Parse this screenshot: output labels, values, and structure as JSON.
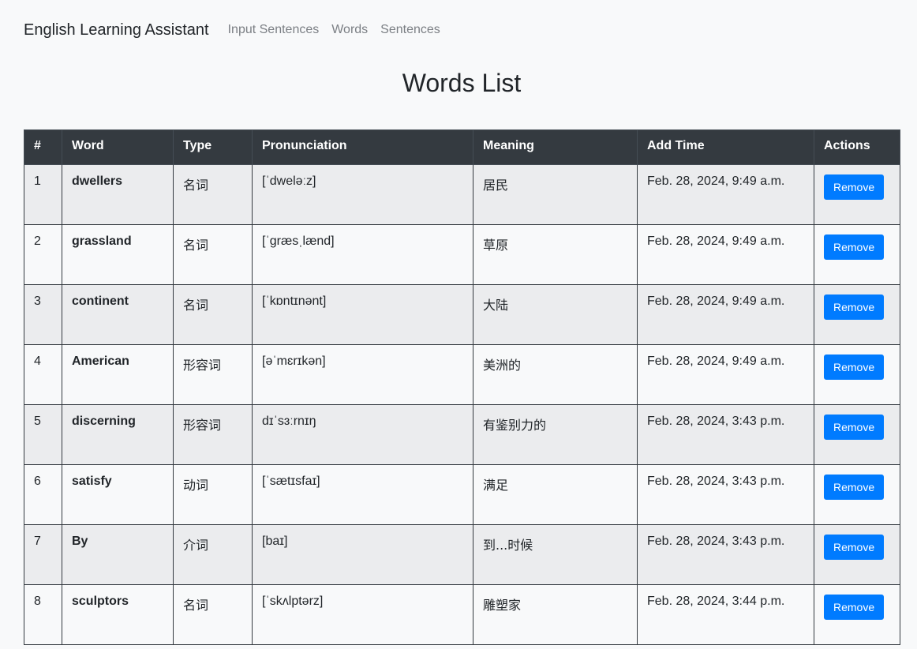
{
  "navbar": {
    "brand": "English Learning Assistant",
    "links": [
      "Input Sentences",
      "Words",
      "Sentences"
    ]
  },
  "page": {
    "title": "Words List"
  },
  "table": {
    "headers": [
      "#",
      "Word",
      "Type",
      "Pronunciation",
      "Meaning",
      "Add Time",
      "Actions"
    ],
    "rows": [
      {
        "num": "1",
        "word": "dwellers",
        "type": "名词",
        "pron": "[ˈdweləːz]",
        "meaning": "居民",
        "time": "Feb. 28, 2024, 9:49 a.m."
      },
      {
        "num": "2",
        "word": "grassland",
        "type": "名词",
        "pron": "[ˈɡræsˌlænd]",
        "meaning": "草原",
        "time": "Feb. 28, 2024, 9:49 a.m."
      },
      {
        "num": "3",
        "word": "continent",
        "type": "名词",
        "pron": "[ˈkɒntɪnənt]",
        "meaning": "大陆",
        "time": "Feb. 28, 2024, 9:49 a.m."
      },
      {
        "num": "4",
        "word": "American",
        "type": "形容词",
        "pron": "[əˈmɛrɪkən]",
        "meaning": "美洲的",
        "time": "Feb. 28, 2024, 9:49 a.m."
      },
      {
        "num": "5",
        "word": "discerning",
        "type": "形容词",
        "pron": "dɪˈsɜːrnɪŋ",
        "meaning": "有鉴别力的",
        "time": "Feb. 28, 2024, 3:43 p.m."
      },
      {
        "num": "6",
        "word": "satisfy",
        "type": "动词",
        "pron": "[ˈsætɪsfaɪ]",
        "meaning": "满足",
        "time": "Feb. 28, 2024, 3:43 p.m."
      },
      {
        "num": "7",
        "word": "By",
        "type": "介词",
        "pron": "[baɪ]",
        "meaning": "到...时候",
        "time": "Feb. 28, 2024, 3:43 p.m."
      },
      {
        "num": "8",
        "word": "sculptors",
        "type": "名词",
        "pron": "[ˈskʌlptərz]",
        "meaning": "雕塑家",
        "time": "Feb. 28, 2024, 3:44 p.m."
      }
    ],
    "action_label": "Remove"
  },
  "colors": {
    "header_bg": "#343a40",
    "button": "#007bff",
    "page_bg": "#f8f9fa"
  }
}
